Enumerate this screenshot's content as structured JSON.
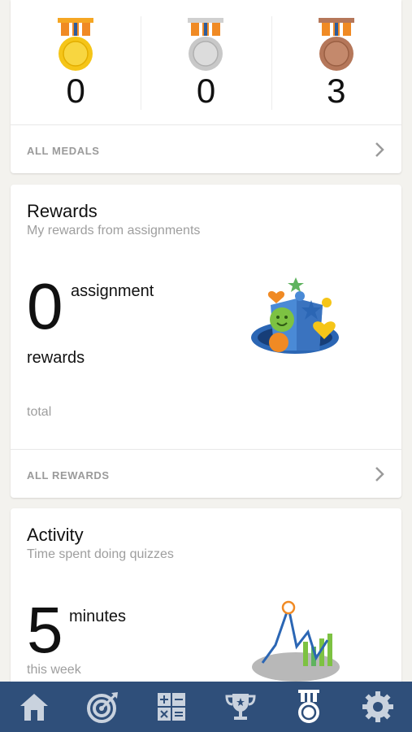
{
  "medals": {
    "items": [
      {
        "type": "gold",
        "count": "0",
        "color": "#f5c518"
      },
      {
        "type": "silver",
        "count": "0",
        "color": "#c8c8c8"
      },
      {
        "type": "bronze",
        "count": "3",
        "color": "#b5775a"
      }
    ],
    "footer_label": "ALL MEDALS"
  },
  "rewards": {
    "title": "Rewards",
    "subtitle": "My rewards from assignments",
    "count": "0",
    "unit_top": "assignment",
    "unit_bottom": "rewards",
    "period": "total",
    "footer_label": "ALL REWARDS"
  },
  "activity": {
    "title": "Activity",
    "subtitle": "Time spent doing quizzes",
    "count": "5",
    "unit": "minutes",
    "period": "this week"
  },
  "tab_bar": {
    "background": "#2f4f7a",
    "tabs": [
      {
        "icon": "home-icon",
        "active": false
      },
      {
        "icon": "target-icon",
        "active": false
      },
      {
        "icon": "calculator-icon",
        "active": false
      },
      {
        "icon": "trophy-icon",
        "active": false
      },
      {
        "icon": "medal-icon",
        "active": true
      },
      {
        "icon": "gear-icon",
        "active": false
      }
    ]
  }
}
